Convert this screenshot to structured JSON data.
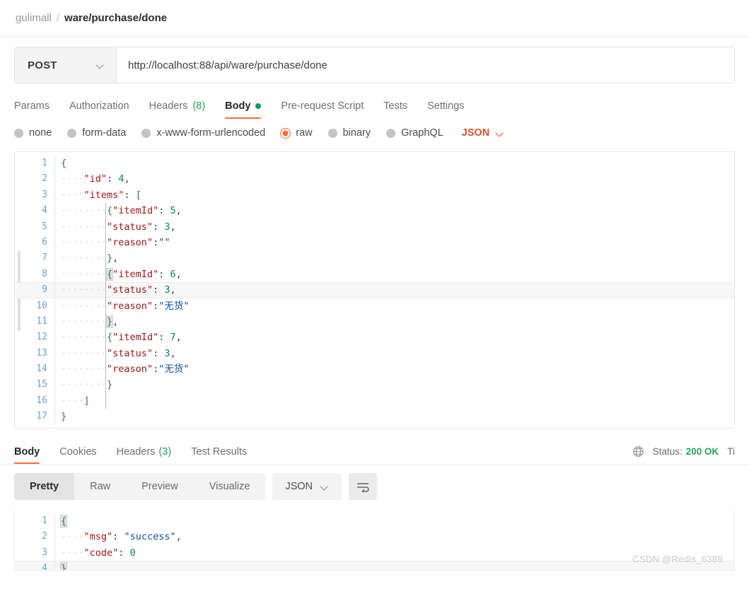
{
  "breadcrumb": {
    "root": "gulimall",
    "separator": "/",
    "current": "ware/purchase/done"
  },
  "request": {
    "method": "POST",
    "url": "http://localhost:88/api/ware/purchase/done",
    "tabs": [
      {
        "label": "Params",
        "active": false
      },
      {
        "label": "Authorization",
        "active": false
      },
      {
        "label": "Headers",
        "count": "(8)",
        "active": false
      },
      {
        "label": "Body",
        "active": true,
        "dot": true
      },
      {
        "label": "Pre-request Script",
        "active": false
      },
      {
        "label": "Tests",
        "active": false
      },
      {
        "label": "Settings",
        "active": false
      }
    ],
    "body_types": [
      {
        "label": "none",
        "selected": false
      },
      {
        "label": "form-data",
        "selected": false
      },
      {
        "label": "x-www-form-urlencoded",
        "selected": false
      },
      {
        "label": "raw",
        "selected": true
      },
      {
        "label": "binary",
        "selected": false
      },
      {
        "label": "GraphQL",
        "selected": false
      }
    ],
    "raw_format": "JSON",
    "body_lines": [
      {
        "num": "1",
        "text": "{"
      },
      {
        "num": "2",
        "text": "    \"id\": 4,"
      },
      {
        "num": "3",
        "text": "    \"items\": ["
      },
      {
        "num": "4",
        "text": "        {\"itemId\": 5,"
      },
      {
        "num": "5",
        "text": "        \"status\": 3,"
      },
      {
        "num": "6",
        "text": "        \"reason\":\"\""
      },
      {
        "num": "7",
        "text": "        },"
      },
      {
        "num": "8",
        "text": "        {\"itemId\": 6,"
      },
      {
        "num": "9",
        "text": "        \"status\": 3,"
      },
      {
        "num": "10",
        "text": "        \"reason\":\"无货\""
      },
      {
        "num": "11",
        "text": "        },"
      },
      {
        "num": "12",
        "text": "        {\"itemId\": 7,"
      },
      {
        "num": "13",
        "text": "        \"status\": 3,"
      },
      {
        "num": "14",
        "text": "        \"reason\":\"无货\""
      },
      {
        "num": "15",
        "text": "        }"
      },
      {
        "num": "16",
        "text": "    ]"
      },
      {
        "num": "17",
        "text": "}"
      }
    ]
  },
  "response": {
    "tabs": [
      {
        "label": "Body",
        "active": true
      },
      {
        "label": "Cookies",
        "active": false
      },
      {
        "label": "Headers",
        "count": "(3)",
        "active": false
      },
      {
        "label": "Test Results",
        "active": false
      }
    ],
    "status_label": "Status:",
    "status_value": "200 OK",
    "time_label": "Ti",
    "view_modes": [
      {
        "label": "Pretty",
        "active": true
      },
      {
        "label": "Raw",
        "active": false
      },
      {
        "label": "Preview",
        "active": false
      },
      {
        "label": "Visualize",
        "active": false
      }
    ],
    "format": "JSON",
    "body_lines": [
      {
        "num": "1",
        "text": "{"
      },
      {
        "num": "2",
        "text": "    \"msg\": \"success\","
      },
      {
        "num": "3",
        "text": "    \"code\": 0"
      },
      {
        "num": "4",
        "text": "}"
      }
    ]
  },
  "watermark": "CSDN @Redis_6389",
  "colors": {
    "accent": "#ff6c37",
    "success": "#29a05e",
    "json_label": "#d9512c",
    "key": "#a31515",
    "string": "#0451a5",
    "number": "#098658",
    "line_number": "#6ea4c8"
  }
}
